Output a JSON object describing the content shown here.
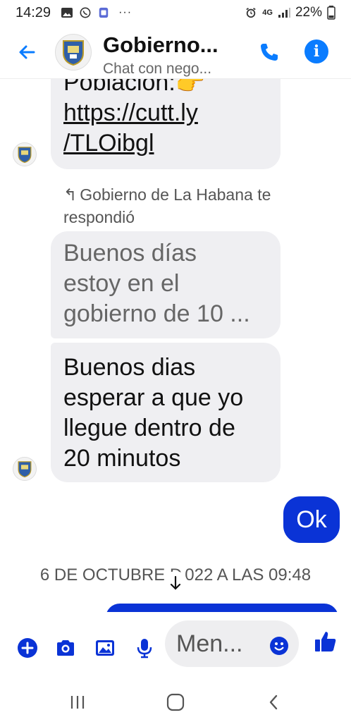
{
  "status_bar": {
    "time": "14:29",
    "dots": "···",
    "network": "4G",
    "battery": "22%"
  },
  "header": {
    "title": "Gobierno...",
    "subtitle": "Chat con nego..."
  },
  "messages": {
    "m1": {
      "line1": "Población:👉",
      "link1": "https://cutt.ly",
      "link2": "/TLOibgl"
    },
    "reply_note": "Gobierno de La Habana te respondió",
    "quoted": {
      "line1": "Buenos días",
      "line2": "estoy en el",
      "line3": "gobierno de 10 ..."
    },
    "m2": {
      "line1": "Buenos dias",
      "line2": "esperar a que yo",
      "line3": "llegue dentro de",
      "line4": "20 minutos"
    },
    "outgoing": "Ok"
  },
  "date_separator": "6 DE OCTUBRE D  022 A LAS 09:48",
  "composer": {
    "placeholder": "Men..."
  },
  "colors": {
    "accent": "#0a7cff",
    "outgoing_bubble": "#0a33d6",
    "incoming_bubble": "#efeff2",
    "icon_blue": "#0a33d6"
  }
}
